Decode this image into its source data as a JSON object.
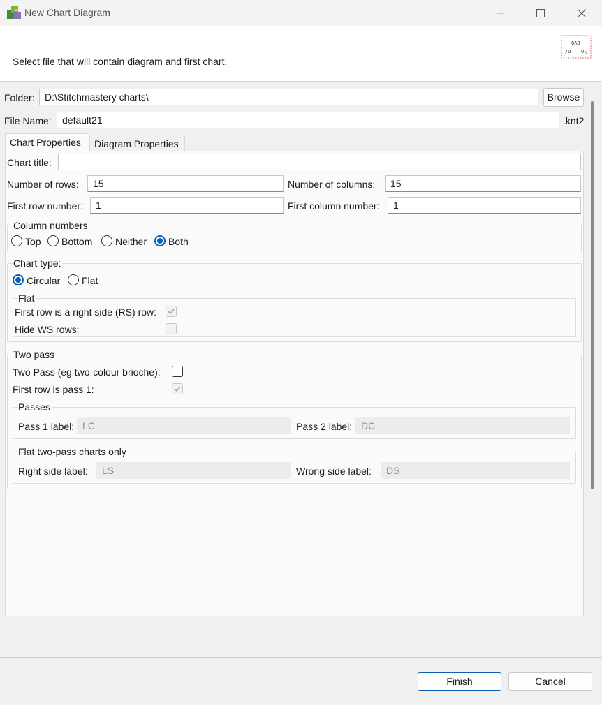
{
  "window": {
    "title": "New Chart Diagram"
  },
  "header": {
    "message": "Select file that will contain diagram and first chart."
  },
  "file": {
    "folder_label": "Folder:",
    "folder_value": "D:\\Stitchmastery charts\\",
    "browse_label": "Browse",
    "filename_label": "File Name:",
    "filename_value": "default21",
    "extension": ".knt2"
  },
  "tabs": [
    "Chart Properties",
    "Diagram Properties"
  ],
  "chart": {
    "title_label": "Chart title:",
    "title_value": "",
    "rows_label": "Number of rows:",
    "rows_value": "15",
    "columns_label": "Number of columns:",
    "columns_value": "15",
    "first_row_label": "First row number:",
    "first_row_value": "1",
    "first_col_label": "First column number:",
    "first_col_value": "1"
  },
  "column_numbers": {
    "title": "Column numbers",
    "options": [
      "Top",
      "Bottom",
      "Neither",
      "Both"
    ],
    "selected": "Both"
  },
  "chart_type": {
    "title": "Chart type:",
    "options": [
      "Circular",
      "Flat"
    ],
    "selected": "Circular",
    "flat_title": "Flat",
    "first_row_rs_label": "First row is a right side (RS) row:",
    "hide_ws_label": "Hide WS rows:"
  },
  "two_pass": {
    "title": "Two pass",
    "two_pass_label": "Two Pass (eg two-colour brioche):",
    "first_pass_label": "First row is pass 1:",
    "passes_title": "Passes",
    "pass1_label": "Pass 1 label:",
    "pass1_value": "LC",
    "pass2_label": "Pass 2 label:",
    "pass2_value": "DC",
    "flat_title": "Flat two-pass charts only",
    "right_label": "Right side label:",
    "right_value": "LS",
    "wrong_label": "Wrong side label:",
    "wrong_value": "DS"
  },
  "footer": {
    "finish_label": "Finish",
    "cancel_label": "Cancel"
  },
  "colors": {
    "accent": "#0b5fb4"
  }
}
